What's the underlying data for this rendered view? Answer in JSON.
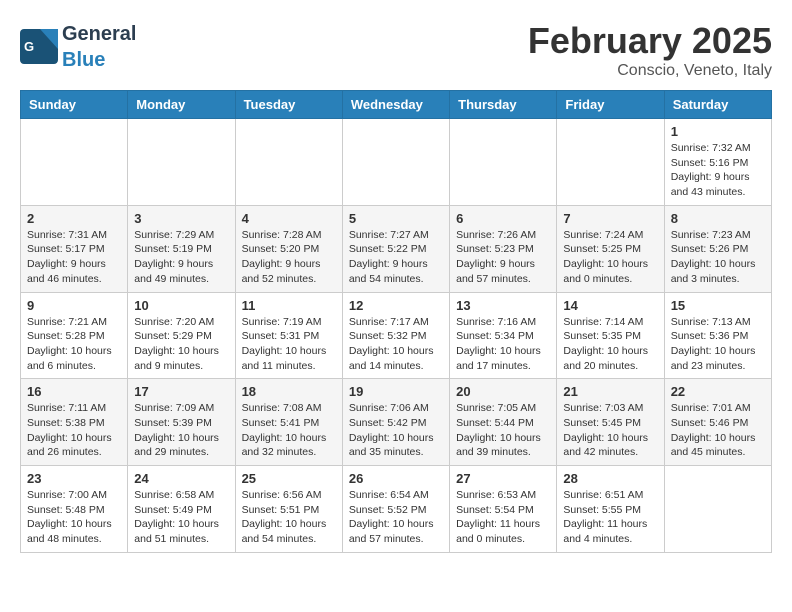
{
  "header": {
    "logo_general": "General",
    "logo_blue": "Blue",
    "month_title": "February 2025",
    "subtitle": "Conscio, Veneto, Italy"
  },
  "calendar": {
    "days_of_week": [
      "Sunday",
      "Monday",
      "Tuesday",
      "Wednesday",
      "Thursday",
      "Friday",
      "Saturday"
    ],
    "weeks": [
      [
        {
          "day": "",
          "info": ""
        },
        {
          "day": "",
          "info": ""
        },
        {
          "day": "",
          "info": ""
        },
        {
          "day": "",
          "info": ""
        },
        {
          "day": "",
          "info": ""
        },
        {
          "day": "",
          "info": ""
        },
        {
          "day": "1",
          "info": "Sunrise: 7:32 AM\nSunset: 5:16 PM\nDaylight: 9 hours and 43 minutes."
        }
      ],
      [
        {
          "day": "2",
          "info": "Sunrise: 7:31 AM\nSunset: 5:17 PM\nDaylight: 9 hours and 46 minutes."
        },
        {
          "day": "3",
          "info": "Sunrise: 7:29 AM\nSunset: 5:19 PM\nDaylight: 9 hours and 49 minutes."
        },
        {
          "day": "4",
          "info": "Sunrise: 7:28 AM\nSunset: 5:20 PM\nDaylight: 9 hours and 52 minutes."
        },
        {
          "day": "5",
          "info": "Sunrise: 7:27 AM\nSunset: 5:22 PM\nDaylight: 9 hours and 54 minutes."
        },
        {
          "day": "6",
          "info": "Sunrise: 7:26 AM\nSunset: 5:23 PM\nDaylight: 9 hours and 57 minutes."
        },
        {
          "day": "7",
          "info": "Sunrise: 7:24 AM\nSunset: 5:25 PM\nDaylight: 10 hours and 0 minutes."
        },
        {
          "day": "8",
          "info": "Sunrise: 7:23 AM\nSunset: 5:26 PM\nDaylight: 10 hours and 3 minutes."
        }
      ],
      [
        {
          "day": "9",
          "info": "Sunrise: 7:21 AM\nSunset: 5:28 PM\nDaylight: 10 hours and 6 minutes."
        },
        {
          "day": "10",
          "info": "Sunrise: 7:20 AM\nSunset: 5:29 PM\nDaylight: 10 hours and 9 minutes."
        },
        {
          "day": "11",
          "info": "Sunrise: 7:19 AM\nSunset: 5:31 PM\nDaylight: 10 hours and 11 minutes."
        },
        {
          "day": "12",
          "info": "Sunrise: 7:17 AM\nSunset: 5:32 PM\nDaylight: 10 hours and 14 minutes."
        },
        {
          "day": "13",
          "info": "Sunrise: 7:16 AM\nSunset: 5:34 PM\nDaylight: 10 hours and 17 minutes."
        },
        {
          "day": "14",
          "info": "Sunrise: 7:14 AM\nSunset: 5:35 PM\nDaylight: 10 hours and 20 minutes."
        },
        {
          "day": "15",
          "info": "Sunrise: 7:13 AM\nSunset: 5:36 PM\nDaylight: 10 hours and 23 minutes."
        }
      ],
      [
        {
          "day": "16",
          "info": "Sunrise: 7:11 AM\nSunset: 5:38 PM\nDaylight: 10 hours and 26 minutes."
        },
        {
          "day": "17",
          "info": "Sunrise: 7:09 AM\nSunset: 5:39 PM\nDaylight: 10 hours and 29 minutes."
        },
        {
          "day": "18",
          "info": "Sunrise: 7:08 AM\nSunset: 5:41 PM\nDaylight: 10 hours and 32 minutes."
        },
        {
          "day": "19",
          "info": "Sunrise: 7:06 AM\nSunset: 5:42 PM\nDaylight: 10 hours and 35 minutes."
        },
        {
          "day": "20",
          "info": "Sunrise: 7:05 AM\nSunset: 5:44 PM\nDaylight: 10 hours and 39 minutes."
        },
        {
          "day": "21",
          "info": "Sunrise: 7:03 AM\nSunset: 5:45 PM\nDaylight: 10 hours and 42 minutes."
        },
        {
          "day": "22",
          "info": "Sunrise: 7:01 AM\nSunset: 5:46 PM\nDaylight: 10 hours and 45 minutes."
        }
      ],
      [
        {
          "day": "23",
          "info": "Sunrise: 7:00 AM\nSunset: 5:48 PM\nDaylight: 10 hours and 48 minutes."
        },
        {
          "day": "24",
          "info": "Sunrise: 6:58 AM\nSunset: 5:49 PM\nDaylight: 10 hours and 51 minutes."
        },
        {
          "day": "25",
          "info": "Sunrise: 6:56 AM\nSunset: 5:51 PM\nDaylight: 10 hours and 54 minutes."
        },
        {
          "day": "26",
          "info": "Sunrise: 6:54 AM\nSunset: 5:52 PM\nDaylight: 10 hours and 57 minutes."
        },
        {
          "day": "27",
          "info": "Sunrise: 6:53 AM\nSunset: 5:54 PM\nDaylight: 11 hours and 0 minutes."
        },
        {
          "day": "28",
          "info": "Sunrise: 6:51 AM\nSunset: 5:55 PM\nDaylight: 11 hours and 4 minutes."
        },
        {
          "day": "",
          "info": ""
        }
      ]
    ]
  }
}
